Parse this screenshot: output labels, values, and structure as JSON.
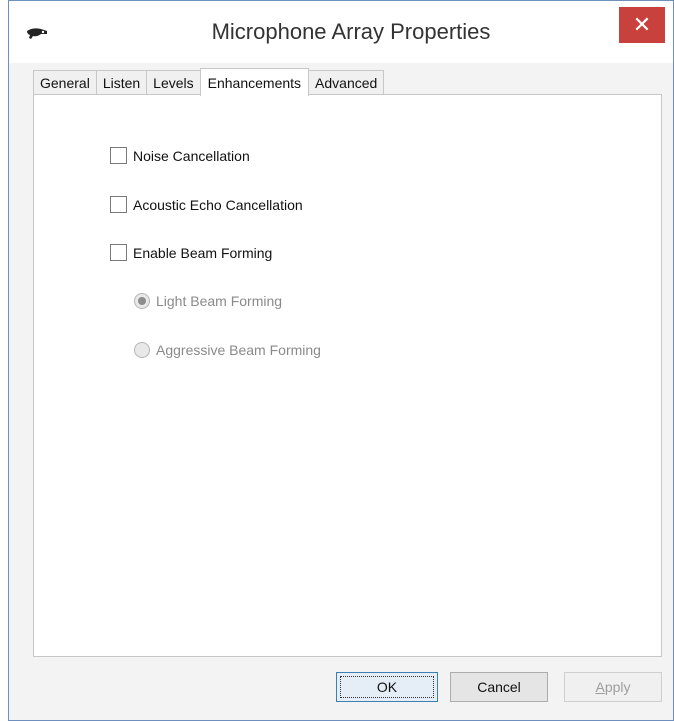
{
  "window": {
    "title": "Microphone Array Properties",
    "close_glyph": "✕"
  },
  "tabs": [
    {
      "label": "General",
      "active": false
    },
    {
      "label": "Listen",
      "active": false
    },
    {
      "label": "Levels",
      "active": false
    },
    {
      "label": "Enhancements",
      "active": true
    },
    {
      "label": "Advanced",
      "active": false
    }
  ],
  "enhancements": {
    "checkboxes": [
      {
        "label": "Noise Cancellation",
        "checked": false
      },
      {
        "label": "Acoustic Echo Cancellation",
        "checked": false
      },
      {
        "label": "Enable Beam Forming",
        "checked": false
      }
    ],
    "radios": [
      {
        "label": "Light Beam Forming",
        "selected": true,
        "enabled": false
      },
      {
        "label": "Aggressive Beam Forming",
        "selected": false,
        "enabled": false
      }
    ]
  },
  "buttons": {
    "ok": "OK",
    "cancel": "Cancel",
    "apply_first": "A",
    "apply_rest": "pply"
  },
  "colors": {
    "close_button": "#c9413c",
    "window_border": "#6f8fbf"
  }
}
